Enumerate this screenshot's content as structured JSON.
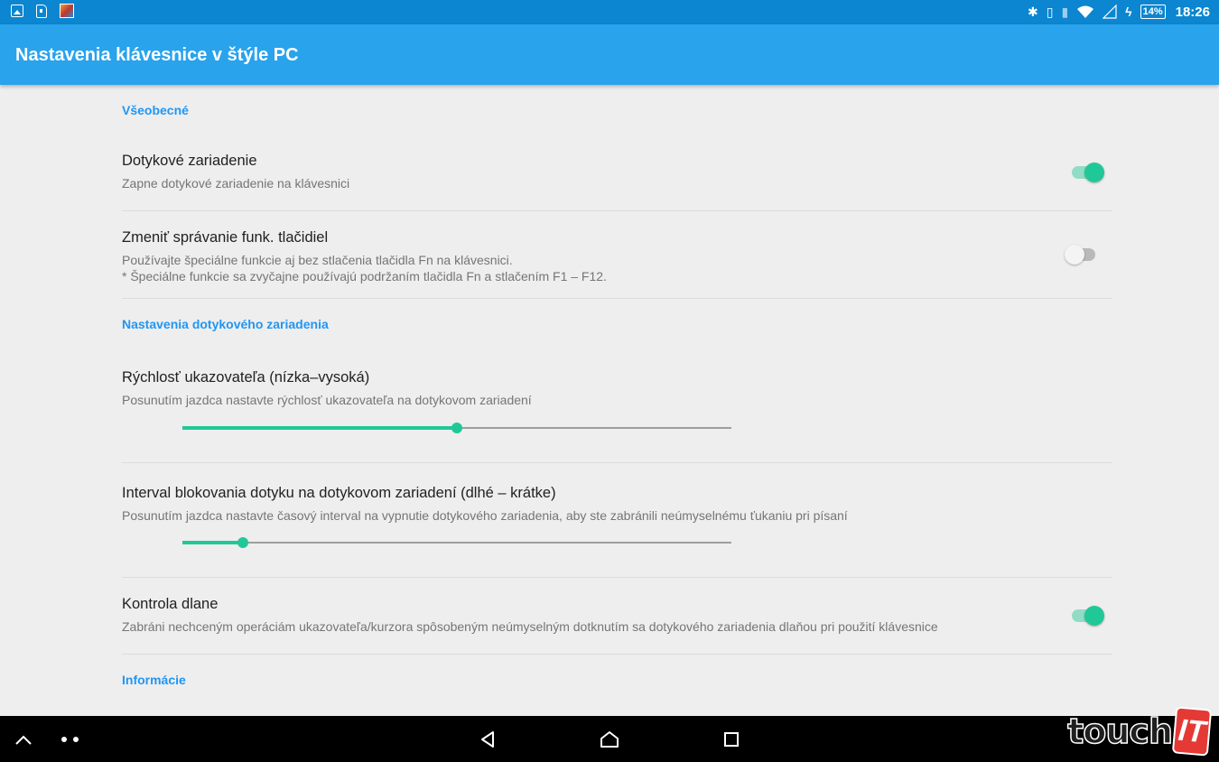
{
  "status_bar": {
    "left_icons": [
      "image-icon",
      "sd-card-icon",
      "app-icon"
    ],
    "right_icons": [
      "bluetooth-icon",
      "vibrate-icon",
      "info-icon",
      "wifi-icon",
      "cell-signal-icon",
      "charging-icon"
    ],
    "battery": "14%",
    "time": "18:26"
  },
  "app_bar": {
    "title": "Nastavenia klávesnice v štýle PC"
  },
  "sections": {
    "general": "Všeobecné",
    "touchpad_settings": "Nastavenia dotykového zariadenia",
    "info": "Informácie"
  },
  "prefs": {
    "touchpad": {
      "title": "Dotykové zariadenie",
      "summary": "Zapne dotykové zariadenie na klávesnici",
      "enabled": true
    },
    "fn_behavior": {
      "title": "Zmeniť správanie funk. tlačidiel",
      "summary_line1": "Používajte špeciálne funkcie aj bez stlačenia tlačidla Fn na klávesnici.",
      "summary_line2": "* Špeciálne funkcie sa zvyčajne používajú podržaním tlačidla Fn a stlačením F1 – F12.",
      "enabled": false
    },
    "pointer_speed": {
      "title": "Rýchlosť ukazovateľa (nízka–vysoká)",
      "summary": "Posunutím jazdca nastavte rýchlosť ukazovateľa na dotykovom zariadení",
      "value": 0.5
    },
    "block_interval": {
      "title": "Interval blokovania dotyku na dotykovom zariadení (dlhé – krátke)",
      "summary": "Posunutím jazdca nastavte časový interval na vypnutie dotykového zariadenia, aby ste zabránili neúmyselnému ťukaniu pri písaní",
      "value": 0.11
    },
    "palm_check": {
      "title": "Kontrola dlane",
      "summary": "Zabráni nechceným operáciám ukazovateľa/kurzora spôsobeným neúmyselným dotknutím sa dotykového zariadenia dlaňou pri použití klávesnice",
      "enabled": true
    }
  },
  "nav_bar": {
    "icons": [
      "chevron-up-icon",
      "more-dots-icon",
      "back-icon",
      "home-icon",
      "recents-icon"
    ]
  },
  "watermark": {
    "text": "touch",
    "badge": "IT"
  },
  "colors": {
    "status_bar": "#0c86d0",
    "app_bar": "#29a3ec",
    "accent": "#21c897",
    "section_header": "#2196f3"
  }
}
